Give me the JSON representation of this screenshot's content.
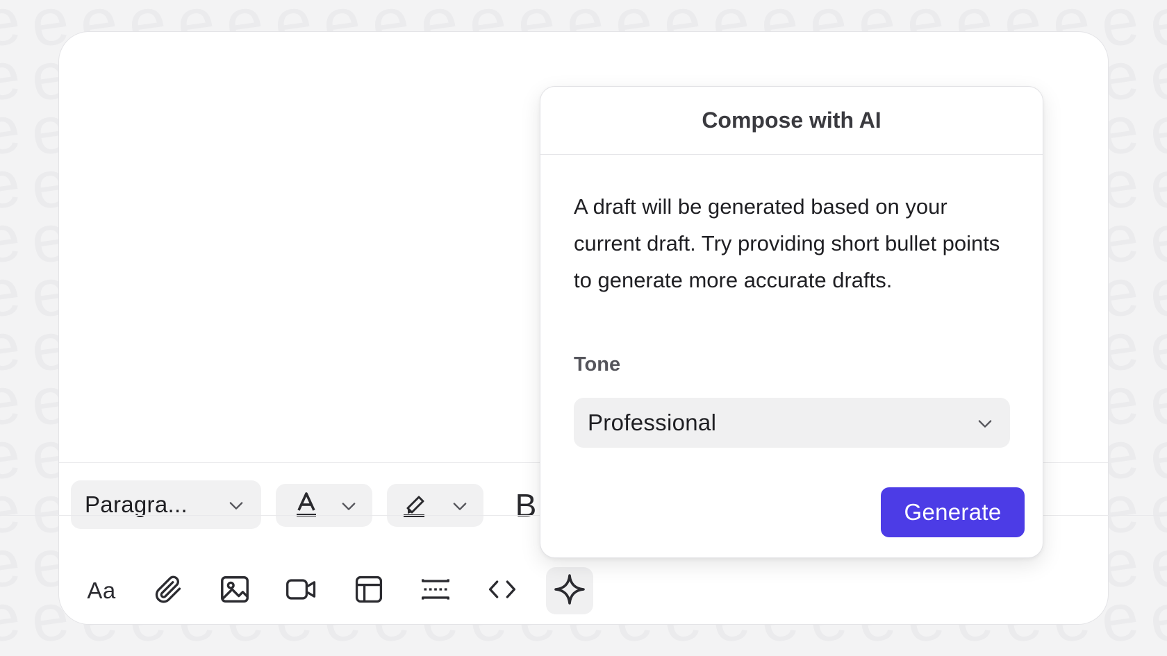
{
  "colors": {
    "accent": "#4c3ce6",
    "background": "#f3f3f4",
    "surface": "#ffffff"
  },
  "toolbar": {
    "paragraph_style": "Paragra...",
    "text_color_icon": "text-color-icon",
    "highlight_icon": "highlighter-icon",
    "bold_label": "B",
    "font_size_label": "Aa",
    "icons": [
      "font-size-icon",
      "paperclip-icon",
      "image-icon",
      "video-icon",
      "table-icon",
      "divider-icon",
      "code-icon",
      "sparkle-icon"
    ]
  },
  "compose_ai": {
    "title": "Compose with AI",
    "description": "A draft will be generated based on your current draft. Try providing short bullet points to generate more accurate drafts.",
    "tone_label": "Tone",
    "tone_value": "Professional",
    "generate_label": "Generate"
  }
}
